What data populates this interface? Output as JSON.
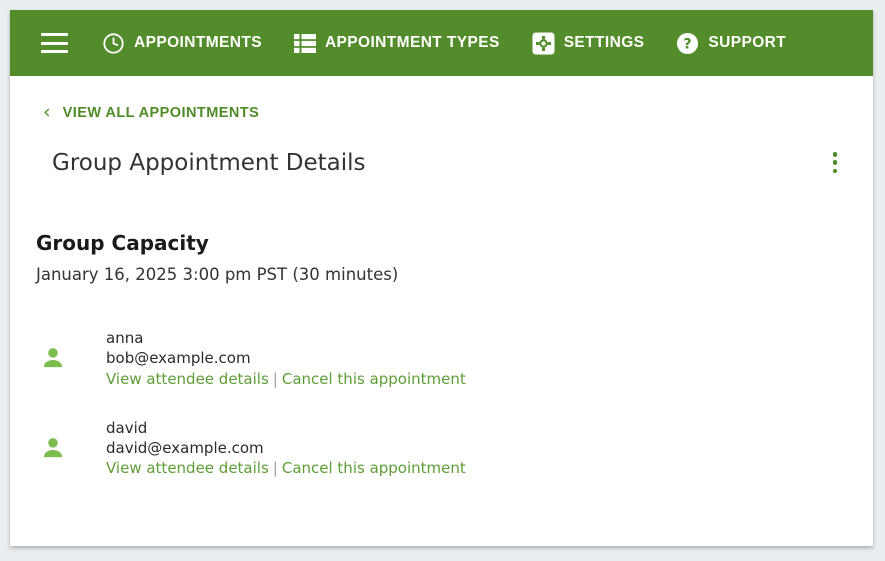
{
  "nav": {
    "menu_icon": "hamburger-menu-icon",
    "items": [
      {
        "label": "APPOINTMENTS",
        "icon": "clock-icon"
      },
      {
        "label": "APPOINTMENT TYPES",
        "icon": "list-table-icon"
      },
      {
        "label": "SETTINGS",
        "icon": "gear-icon"
      },
      {
        "label": "SUPPORT",
        "icon": "question-mark-icon"
      }
    ],
    "background_color": "#538c2b"
  },
  "back_link": {
    "chevron": "‹",
    "label": "VIEW ALL APPOINTMENTS",
    "color": "#4f8b25"
  },
  "detail": {
    "page_title": "Group Appointment Details",
    "kebab_icon": "more-vertical-icon"
  },
  "capacity": {
    "title": "Group Capacity",
    "datetime": "January 16, 2025 3:00 pm PST (30 minutes)"
  },
  "attendees": [
    {
      "avatar_icon": "person-icon",
      "name": "anna",
      "email": "bob@example.com",
      "view_details_label": "View attendee details",
      "separator": "|",
      "cancel_label": "Cancel this appointment"
    },
    {
      "avatar_icon": "person-icon",
      "name": "david",
      "email": "david@example.com",
      "view_details_label": "View attendee details",
      "separator": "|",
      "cancel_label": "Cancel this appointment"
    }
  ],
  "colors": {
    "brand_green": "#538c2b",
    "link_green": "#5d9e36",
    "avatar_green": "#7cbd4f",
    "page_background": "#eaeef0"
  }
}
